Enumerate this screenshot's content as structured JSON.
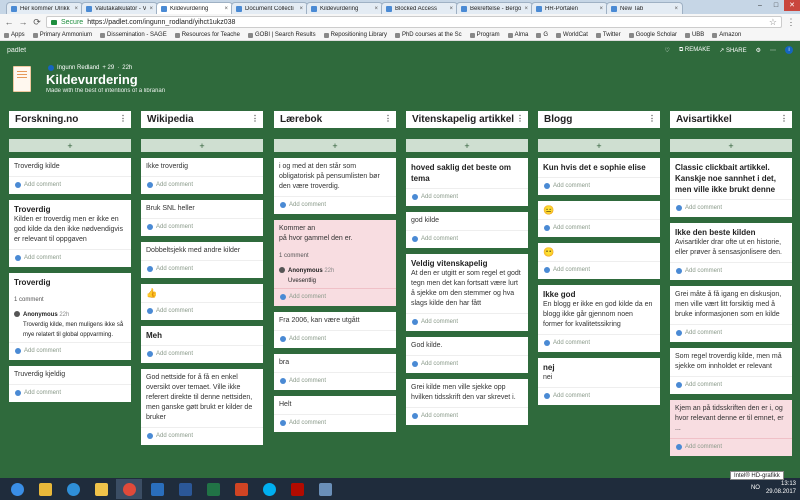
{
  "browser": {
    "tabs": [
      {
        "label": "Her kommer Ulrikk"
      },
      {
        "label": "Valutakalkulator - V"
      },
      {
        "label": "Kildevurdering",
        "active": true
      },
      {
        "label": "Document Collecti"
      },
      {
        "label": "Kildevurdering"
      },
      {
        "label": "Blocked Access"
      },
      {
        "label": "Bekreftelse - Bergo"
      },
      {
        "label": "HR-Portalen"
      },
      {
        "label": "New Tab"
      }
    ],
    "secure_label": "Secure",
    "url": "https://padlet.com/ingunn_rodland/yihct1ukz038",
    "bookmarks": [
      "Apps",
      "Primary Ammonium",
      "Dissemination - SAGE",
      "Resources for Teache",
      "GOBI | Search Results",
      "Repositioning Library",
      "PhD courses at the Sc",
      "Program",
      "Alma",
      "G",
      "WorldCat",
      "Twitter",
      "Google Scholar",
      "UBB",
      "Amazon"
    ]
  },
  "padlet": {
    "brand": "padlet",
    "remake": "REMAKE",
    "share": "SHARE",
    "author": "Ingunn Redland",
    "contributors": "+ 29",
    "age": "22h",
    "title": "Kildevurdering",
    "subtitle": "Made with the best of intentions of a librarian"
  },
  "add_comment": "Add comment",
  "columns": [
    {
      "name": "Forskning.no",
      "cards": [
        {
          "text": "Troverdig kilde"
        },
        {
          "title": "Troverdig",
          "text": "Kilden er troverdig men er ikke en god kilde da den ikke nødvendigvis er relevant til oppgaven"
        },
        {
          "title": "Troverdig",
          "count": "1 comment",
          "reply_name": "Anonymous",
          "reply_time": "22h",
          "reply_text": "Troverdig kilde, men muligens ikke så mye relatert til global oppvarming."
        },
        {
          "text": "Truverdig kjeldig"
        }
      ]
    },
    {
      "name": "Wikipedia",
      "cards": [
        {
          "text": "Ikke troverdig"
        },
        {
          "text": "Bruk SNL heller"
        },
        {
          "text": "Dobbeltsjekk med andre kilder"
        },
        {
          "emoji": "👍"
        },
        {
          "title": "Meh"
        },
        {
          "text": "God nettside for å få en enkel oversikt over temaet. Ville ikke referert direkte til denne nettsiden, men ganske gøtt brukt er kilder de bruker"
        }
      ]
    },
    {
      "name": "Lærebok",
      "cards": [
        {
          "text": "i og med at den står som obligatorisk på pensumlisten bør den være troverdig."
        },
        {
          "text": "Kommer an\npå hvor gammel den er.",
          "pink": true,
          "count": "1 comment",
          "reply_name": "Anonymous",
          "reply_time": "22h",
          "reply_text": "Uvesentlig"
        },
        {
          "text": "Fra 2006, kan være utgått"
        },
        {
          "text": "bra"
        },
        {
          "text": "Helt"
        }
      ]
    },
    {
      "name": "Vitenskapelig artikkel",
      "cards": [
        {
          "title": "hoved saklig det beste om tema"
        },
        {
          "text": "god kilde"
        },
        {
          "title": "Veldig vitenskapelig",
          "text": "At den er utgitt er som regel et godt tegn men det kan fortsatt være lurt å sjekke om den stemmer og hva slags kilde den har fått"
        },
        {
          "text": "God kilde."
        },
        {
          "text": "Grei kilde men ville sjekke opp hvilken tidsskrift den var skrevet i."
        }
      ]
    },
    {
      "name": "Blogg",
      "cards": [
        {
          "title": "Kun hvis det e sophie elise"
        },
        {
          "emoji": "😑"
        },
        {
          "emoji": "😶"
        },
        {
          "title": "Ikke god",
          "text": "En blogg er ikke en god kilde da en blogg ikke går gjennom noen former for kvalitetssikring"
        },
        {
          "title": "nej",
          "text": "nei"
        }
      ]
    },
    {
      "name": "Avisartikkel",
      "cards": [
        {
          "title": "Classic clickbait artikkel. Kanskje noe sannhet i det, men ville ikke brukt denne"
        },
        {
          "title": "Ikke den beste kilden",
          "text": "Avisartikler drar ofte ut en historie, eller prøver å sensasjonlisere den."
        },
        {
          "text": "Grei måte å få igang en diskusjon, men ville vært litt forsiktig med å bruke informasjonen som en kilde"
        },
        {
          "text": "Som regel troverdig kilde, men må sjekke om innholdet er relevant"
        },
        {
          "text": "Kjem an på tidsskriften den er i, og hvor relevant denne er til emnet, er ...",
          "pink": true
        }
      ]
    }
  ],
  "taskbar": {
    "tray_lang": "NO",
    "time": "13:13",
    "date": "29.08.2017",
    "tooltip": "Intel® HD-grafikk"
  }
}
